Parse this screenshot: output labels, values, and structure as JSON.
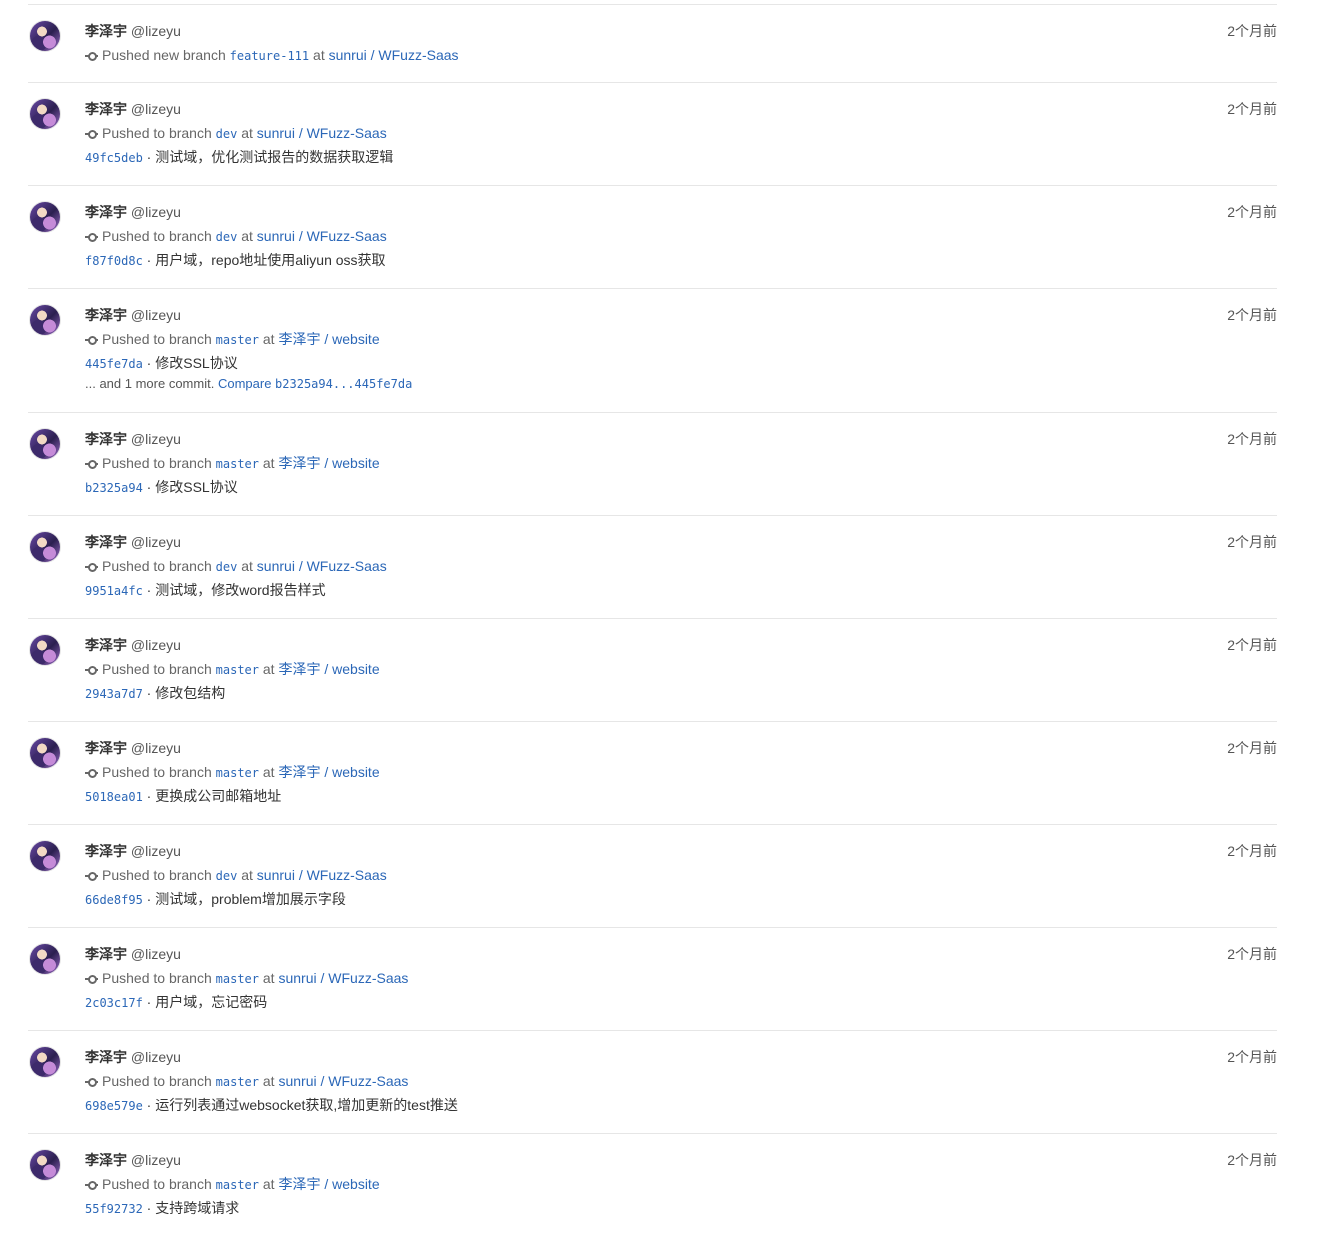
{
  "events": [
    {
      "author": "李泽宇",
      "handle": "@lizeyu",
      "time": "2个月前",
      "action": "Pushed new branch",
      "branch": "feature-111",
      "at": "at",
      "repo": "sunrui / WFuzz-Saas",
      "commit_hash": "",
      "commit_message": "",
      "more_text": "",
      "compare_label": "",
      "compare_range": ""
    },
    {
      "author": "李泽宇",
      "handle": "@lizeyu",
      "time": "2个月前",
      "action": "Pushed to branch",
      "branch": "dev",
      "at": "at",
      "repo": "sunrui / WFuzz-Saas",
      "commit_hash": "49fc5deb",
      "commit_message": "测试域，优化测试报告的数据获取逻辑",
      "more_text": "",
      "compare_label": "",
      "compare_range": ""
    },
    {
      "author": "李泽宇",
      "handle": "@lizeyu",
      "time": "2个月前",
      "action": "Pushed to branch",
      "branch": "dev",
      "at": "at",
      "repo": "sunrui / WFuzz-Saas",
      "commit_hash": "f87f0d8c",
      "commit_message": "用户域，repo地址使用aliyun oss获取",
      "more_text": "",
      "compare_label": "",
      "compare_range": ""
    },
    {
      "author": "李泽宇",
      "handle": "@lizeyu",
      "time": "2个月前",
      "action": "Pushed to branch",
      "branch": "master",
      "at": "at",
      "repo": "李泽宇 / website",
      "commit_hash": "445fe7da",
      "commit_message": "修改SSL协议",
      "more_text": "... and 1 more commit.",
      "compare_label": "Compare",
      "compare_range": "b2325a94...445fe7da"
    },
    {
      "author": "李泽宇",
      "handle": "@lizeyu",
      "time": "2个月前",
      "action": "Pushed to branch",
      "branch": "master",
      "at": "at",
      "repo": "李泽宇 / website",
      "commit_hash": "b2325a94",
      "commit_message": "修改SSL协议",
      "more_text": "",
      "compare_label": "",
      "compare_range": ""
    },
    {
      "author": "李泽宇",
      "handle": "@lizeyu",
      "time": "2个月前",
      "action": "Pushed to branch",
      "branch": "dev",
      "at": "at",
      "repo": "sunrui / WFuzz-Saas",
      "commit_hash": "9951a4fc",
      "commit_message": "测试域，修改word报告样式",
      "more_text": "",
      "compare_label": "",
      "compare_range": ""
    },
    {
      "author": "李泽宇",
      "handle": "@lizeyu",
      "time": "2个月前",
      "action": "Pushed to branch",
      "branch": "master",
      "at": "at",
      "repo": "李泽宇 / website",
      "commit_hash": "2943a7d7",
      "commit_message": "修改包结构",
      "more_text": "",
      "compare_label": "",
      "compare_range": ""
    },
    {
      "author": "李泽宇",
      "handle": "@lizeyu",
      "time": "2个月前",
      "action": "Pushed to branch",
      "branch": "master",
      "at": "at",
      "repo": "李泽宇 / website",
      "commit_hash": "5018ea01",
      "commit_message": "更换成公司邮箱地址",
      "more_text": "",
      "compare_label": "",
      "compare_range": ""
    },
    {
      "author": "李泽宇",
      "handle": "@lizeyu",
      "time": "2个月前",
      "action": "Pushed to branch",
      "branch": "dev",
      "at": "at",
      "repo": "sunrui / WFuzz-Saas",
      "commit_hash": "66de8f95",
      "commit_message": "测试域，problem增加展示字段",
      "more_text": "",
      "compare_label": "",
      "compare_range": ""
    },
    {
      "author": "李泽宇",
      "handle": "@lizeyu",
      "time": "2个月前",
      "action": "Pushed to branch",
      "branch": "master",
      "at": "at",
      "repo": "sunrui / WFuzz-Saas",
      "commit_hash": "2c03c17f",
      "commit_message": "用户域，忘记密码",
      "more_text": "",
      "compare_label": "",
      "compare_range": ""
    },
    {
      "author": "李泽宇",
      "handle": "@lizeyu",
      "time": "2个月前",
      "action": "Pushed to branch",
      "branch": "master",
      "at": "at",
      "repo": "sunrui / WFuzz-Saas",
      "commit_hash": "698e579e",
      "commit_message": "运行列表通过websocket获取,增加更新的test推送",
      "more_text": "",
      "compare_label": "",
      "compare_range": ""
    },
    {
      "author": "李泽宇",
      "handle": "@lizeyu",
      "time": "2个月前",
      "action": "Pushed to branch",
      "branch": "master",
      "at": "at",
      "repo": "李泽宇 / website",
      "commit_hash": "55f92732",
      "commit_message": "支持跨域请求",
      "more_text": "",
      "compare_label": "",
      "compare_range": ""
    }
  ]
}
